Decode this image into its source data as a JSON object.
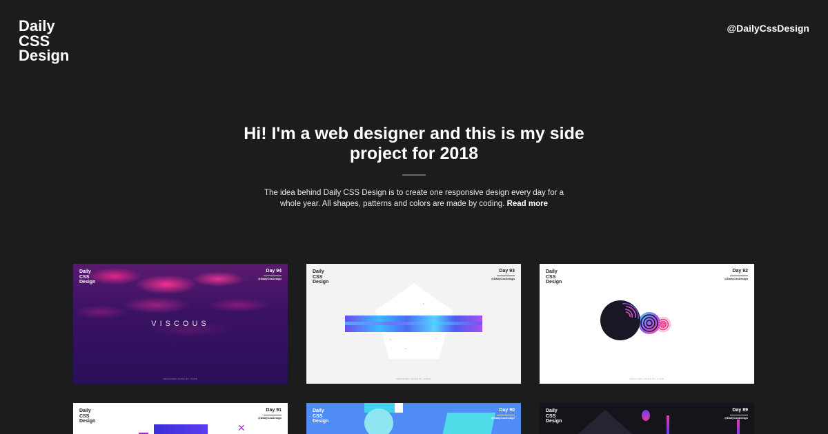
{
  "header": {
    "logo_lines": [
      "Daily",
      "CSS",
      "Design"
    ],
    "handle": "@DailyCssDesign"
  },
  "hero": {
    "title": "Hi! I'm a web designer and this is my side project for 2018",
    "intro": "The idea behind Daily CSS Design is to create one responsive design every day for a whole year. All shapes, patterns and colors are made by coding.",
    "read_more": "Read more"
  },
  "cards": [
    {
      "day": "Day 94",
      "logo_lines": [
        "Daily",
        "CSS",
        "Design"
      ],
      "handle": "@DailyCssDesign",
      "caption": "VISCOUS",
      "footer": "DESIGNED MADE BY CODE"
    },
    {
      "day": "Day 93",
      "logo_lines": [
        "Daily",
        "CSS",
        "Design"
      ],
      "handle": "@DailyCssDesign",
      "footer": "DESIGNED MADE BY CODE"
    },
    {
      "day": "Day 92",
      "logo_lines": [
        "Daily",
        "CSS",
        "Design"
      ],
      "handle": "@DailyCssDesign",
      "footer": "DESIGNED MADE BY CODE"
    },
    {
      "day": "Day 91",
      "logo_lines": [
        "Daily",
        "CSS",
        "Design"
      ],
      "handle": "@DailyCssDesign"
    },
    {
      "day": "Day 90",
      "logo_lines": [
        "Daily",
        "CSS",
        "Design"
      ],
      "handle": "@DailyCssDesign"
    },
    {
      "day": "Day 89",
      "logo_lines": [
        "Daily",
        "CSS",
        "Design"
      ],
      "handle": "@DailyCssDesign"
    }
  ],
  "colors": {
    "background": "#1c1c1c",
    "accent_pink": "#f0329a",
    "accent_blue": "#4f8cf6",
    "accent_purple": "#5a3cf0"
  }
}
